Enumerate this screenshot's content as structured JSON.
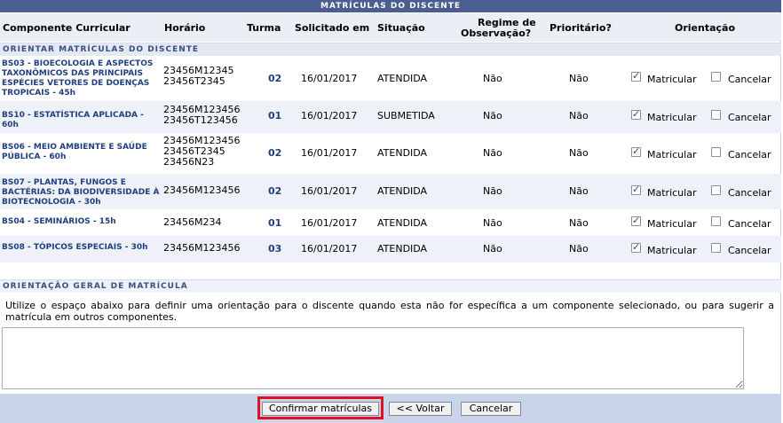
{
  "caption": "Matrículas do Discente",
  "columns": {
    "componente": "Componente Curricular",
    "horario": "Horário",
    "turma": "Turma",
    "solicitado": "Solicitado em",
    "situacao": "Situação",
    "regime_l1": "Regime de",
    "regime_l2": "Observação?",
    "prioritario": "Prioritário?",
    "orientacao": "Orientação"
  },
  "section_orientar": "Orientar matrículas do discente",
  "rows": [
    {
      "componente": "BS03 - BIOECOLOGIA E ASPECTOS TAXONÔMICOS DAS PRINCIPAIS ESPÉCIES VETORES DE DOENÇAS TROPICAIS - 45h",
      "horario": "23456M12345\n23456T2345",
      "turma": "02",
      "solicitado": "16/01/2017",
      "situacao": "ATENDIDA",
      "regime": "Não",
      "prioritario": "Não",
      "matricular": true,
      "cancelar": false
    },
    {
      "componente": "BS10 - ESTATÍSTICA APLICADA - 60h",
      "horario": "23456M123456\n23456T123456",
      "turma": "01",
      "solicitado": "16/01/2017",
      "situacao": "SUBMETIDA",
      "regime": "Não",
      "prioritario": "Não",
      "matricular": true,
      "cancelar": false
    },
    {
      "componente": "BS06 - MEIO AMBIENTE E SAÚDE PÚBLICA - 60h",
      "horario": "23456M123456\n23456T2345\n23456N23",
      "turma": "02",
      "solicitado": "16/01/2017",
      "situacao": "ATENDIDA",
      "regime": "Não",
      "prioritario": "Não",
      "matricular": true,
      "cancelar": false
    },
    {
      "componente": "BS07 - PLANTAS, FUNGOS E BACTÉRIAS: DA BIODIVERSIDADE À BIOTECNOLOGIA - 30h",
      "horario": "23456M123456",
      "turma": "02",
      "solicitado": "16/01/2017",
      "situacao": "ATENDIDA",
      "regime": "Não",
      "prioritario": "Não",
      "matricular": true,
      "cancelar": false
    },
    {
      "componente": "BS04 - SEMINÁRIOS - 15h",
      "horario": "23456M234",
      "turma": "01",
      "solicitado": "16/01/2017",
      "situacao": "ATENDIDA",
      "regime": "Não",
      "prioritario": "Não",
      "matricular": true,
      "cancelar": false
    },
    {
      "componente": "BS08 - TÓPICOS ESPECIAIS - 30h",
      "horario": "23456M123456",
      "turma": "03",
      "solicitado": "16/01/2017",
      "situacao": "ATENDIDA",
      "regime": "Não",
      "prioritario": "Não",
      "matricular": true,
      "cancelar": false
    }
  ],
  "label_matricular": "Matricular",
  "label_cancelar": "Cancelar",
  "section_geral": "Orientação geral de matrícula",
  "description": "Utilize o espaço abaixo para definir uma orientação para o discente quando esta não for específica a um componente selecionado, ou para sugerir a matrícula em outros componentes.",
  "textarea_value": "",
  "buttons": {
    "confirm": "Confirmar matrículas",
    "back": "<< Voltar",
    "cancel": "Cancelar"
  }
}
